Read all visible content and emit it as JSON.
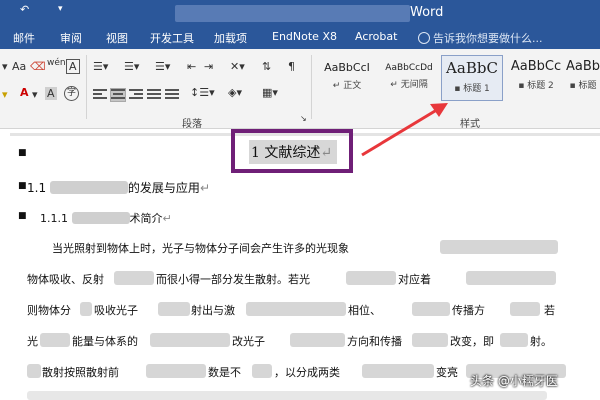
{
  "titlebar": {
    "title": "Word",
    "qat_icon": "undo-arrow-icon"
  },
  "ribbon_tabs": [
    "邮件",
    "审阅",
    "视图",
    "开发工具",
    "加载项",
    "EndNote X8",
    "Acrobat"
  ],
  "tell_me": {
    "placeholder": "告诉我你想要做什么...",
    "icon": "lightbulb-icon"
  },
  "ribbon": {
    "paragraph_group_label": "段落",
    "styles_group_label": "样式",
    "styles": [
      {
        "sample": "AaBbCcI",
        "name": "正文",
        "selected": false
      },
      {
        "sample": "AaBbCcDd",
        "name": "无间隔",
        "selected": false
      },
      {
        "sample": "AaBbC",
        "name": "标题 1",
        "selected": true
      },
      {
        "sample": "AaBbCc",
        "name": "标题 2",
        "selected": false
      },
      {
        "sample": "AaBb",
        "name": "标题",
        "selected": false
      }
    ],
    "font_icons": [
      "eraser-icon",
      "pinyin-icon",
      "char-border-icon"
    ],
    "letter_a": "A",
    "wen_symbol": "文",
    "zimu": "字"
  },
  "document": {
    "heading1": "1 文献综述",
    "heading2_prefix": "1.1",
    "heading2_suffix": "的发展与应用",
    "heading3_prefix": "1.1.1",
    "heading3_suffix": "术简介",
    "paragraphs": [
      "当光照射到物体上时，光子与物体分子间会产生许多的光现象",
      "物体吸收、反射",
      "而很小得一部分发生散射。若光",
      "对应着",
      "则物体分",
      "吸收光子",
      "射出与激",
      "相位、",
      "传播方",
      "若",
      "光",
      "能量与体系的",
      "改光子",
      "方向和传播",
      "改变，即",
      "射。",
      "散射按照散射前",
      "数是不",
      "，以分成两类",
      "变亮"
    ]
  },
  "annotation": {
    "arrow_color": "#e8373b",
    "box_color": "#6f1f77"
  },
  "watermark": "头条 @小糯牙医"
}
